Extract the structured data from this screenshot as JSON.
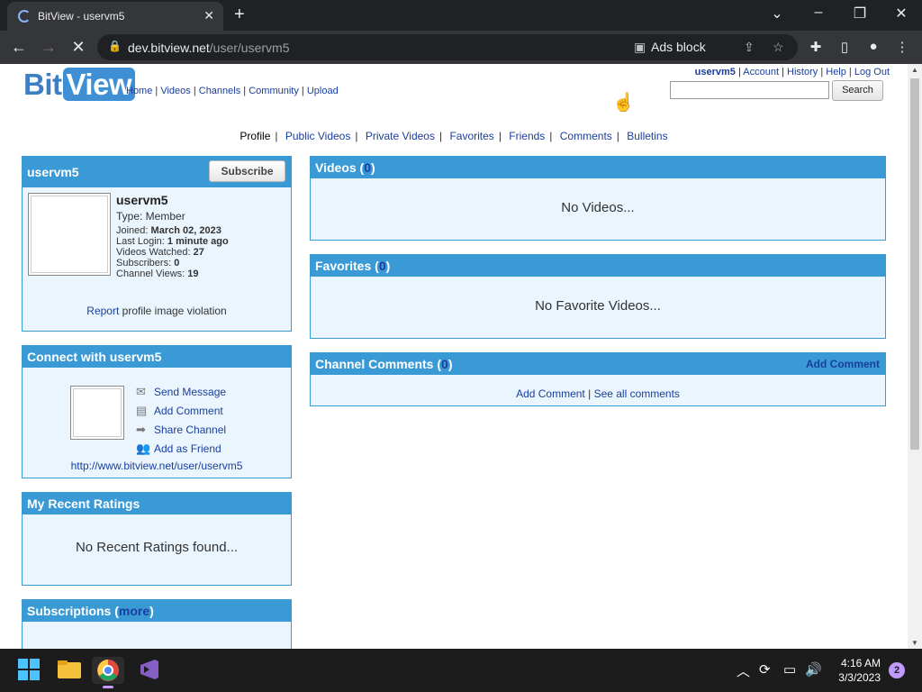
{
  "browser": {
    "tab_title": "BitView - uservm5",
    "url_host": "dev.bitview.net",
    "url_path": "/user/uservm5",
    "ads_block_label": "Ads block"
  },
  "site": {
    "logo_bit": "Bit",
    "logo_view": "View",
    "main_nav": [
      "Home",
      "Videos",
      "Channels",
      "Community",
      "Upload"
    ],
    "user_nav": {
      "username": "uservm5",
      "links": [
        "Account",
        "History",
        "Help",
        "Log Out"
      ]
    },
    "search": {
      "value": "",
      "button": "Search"
    }
  },
  "profile_tabs": {
    "current": "Profile",
    "links": [
      "Public Videos",
      "Private Videos",
      "Favorites",
      "Friends",
      "Comments",
      "Bulletins"
    ]
  },
  "profile_box": {
    "header": "uservm5",
    "subscribe": "Subscribe",
    "name": "uservm5",
    "type": "Type: Member",
    "joined_label": "Joined:",
    "joined": "March 02, 2023",
    "last_login_label": "Last Login:",
    "last_login": "1 minute ago",
    "watched_label": "Videos Watched:",
    "watched": "27",
    "subscribers_label": "Subscribers:",
    "subscribers": "0",
    "views_label": "Channel Views:",
    "views": "19",
    "report_link": "Report",
    "report_text": "profile image violation"
  },
  "connect_box": {
    "header": "Connect with uservm5",
    "actions": [
      "Send Message",
      "Add Comment",
      "Share Channel",
      "Add as Friend"
    ],
    "channel_url": "http://www.bitview.net/user/uservm5"
  },
  "ratings_box": {
    "header": "My Recent Ratings",
    "empty": "No Recent Ratings found..."
  },
  "subs_box": {
    "header": "Subscriptions (",
    "more": "more",
    "close": ")"
  },
  "videos_box": {
    "header": "Videos (",
    "count": "0",
    "close": ")",
    "empty": "No Videos..."
  },
  "favorites_box": {
    "header": "Favorites (",
    "count": "0",
    "close": ")",
    "empty": "No Favorite Videos..."
  },
  "comments_box": {
    "header": "Channel Comments (",
    "count": "0",
    "close": ")",
    "add_link": "Add Comment",
    "link1": "Add Comment",
    "link2": "See all comments"
  },
  "taskbar": {
    "time": "4:16 AM",
    "date": "3/3/2023",
    "notifications": "2"
  }
}
